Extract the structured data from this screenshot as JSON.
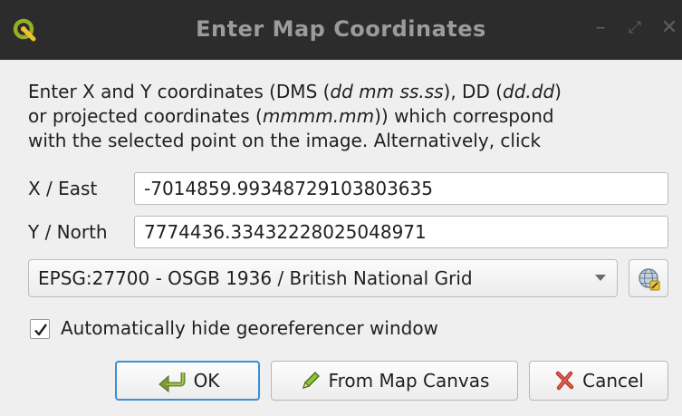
{
  "window": {
    "title": "Enter Map Coordinates",
    "controls": {
      "minimize": "–",
      "restore": "⤢",
      "close": "✕"
    }
  },
  "description": {
    "line1_a": "Enter X and Y coordinates (DMS (",
    "line1_b": "dd mm ss.ss",
    "line1_c": "), DD (",
    "line1_d": "dd.dd",
    "line1_e": ")",
    "line2_a": "or projected coordinates (",
    "line2_b": "mmmm.mm",
    "line2_c": ")) which correspond",
    "line3": "with the selected point on the image. Alternatively, click"
  },
  "x_field": {
    "label": "X / East",
    "value": "-7014859.99348729103803635"
  },
  "y_field": {
    "label": "Y / North",
    "value": "7774436.33432228025048971"
  },
  "crs": {
    "selected": "EPSG:27700 - OSGB 1936 / British National Grid"
  },
  "auto_hide": {
    "label": "Automatically hide georeferencer window",
    "checked": true
  },
  "buttons": {
    "ok": "OK",
    "from_canvas": "From Map Canvas",
    "cancel": "Cancel"
  },
  "colors": {
    "titlebar": "#2c2c2c",
    "accent": "#3a8fd8",
    "logo_green": "#93b023",
    "cancel_red": "#c0392b"
  }
}
